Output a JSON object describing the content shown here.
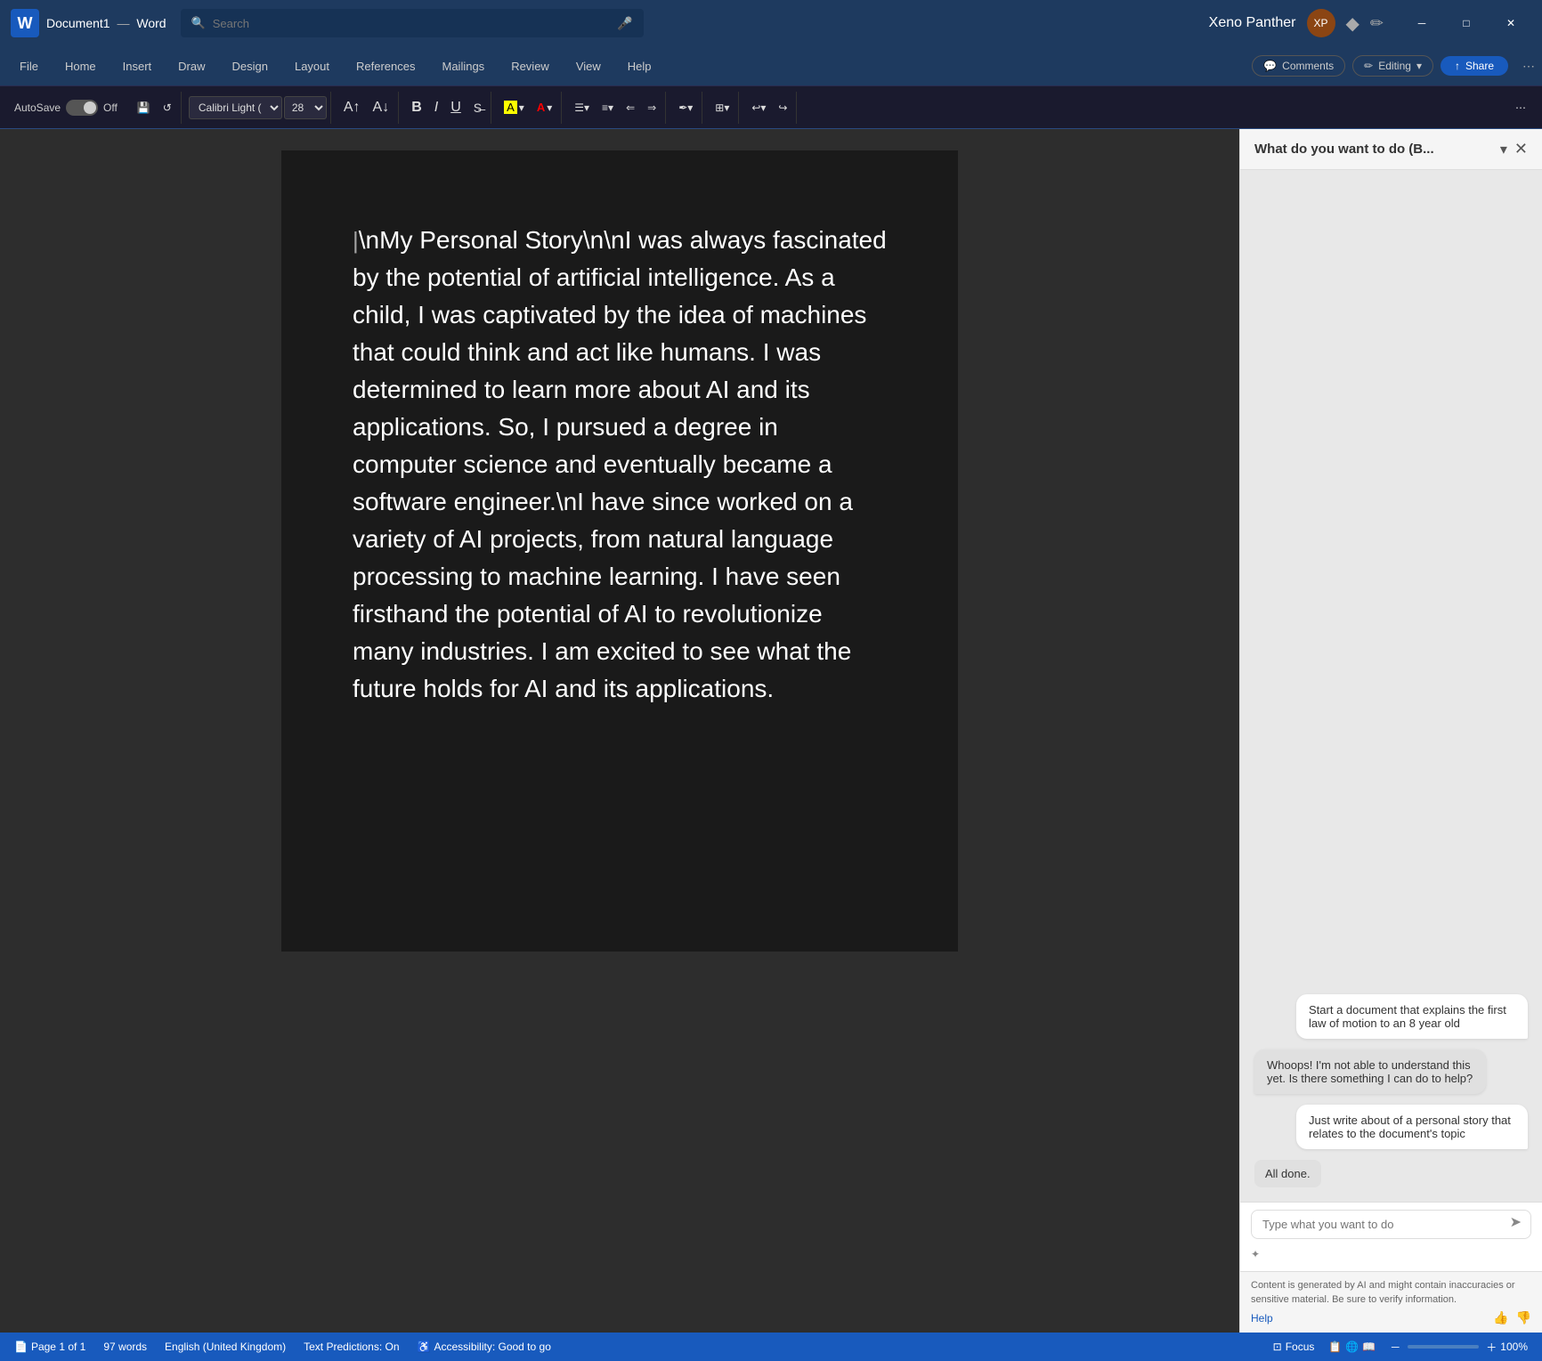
{
  "titlebar": {
    "word_icon": "W",
    "doc_name": "Document1",
    "separator": "—",
    "app_name": "Word",
    "search_placeholder": "Search",
    "mic_icon": "🎤",
    "username": "Xeno Panther",
    "avatar_initials": "XP",
    "minimize_icon": "─",
    "maximize_icon": "□",
    "close_icon": "✕"
  },
  "ribbon": {
    "tabs": [
      {
        "label": "File",
        "active": false
      },
      {
        "label": "Home",
        "active": false
      },
      {
        "label": "Insert",
        "active": false
      },
      {
        "label": "Draw",
        "active": false
      },
      {
        "label": "Design",
        "active": false
      },
      {
        "label": "Layout",
        "active": false
      },
      {
        "label": "References",
        "active": false
      },
      {
        "label": "Mailings",
        "active": false
      },
      {
        "label": "Review",
        "active": false
      },
      {
        "label": "View",
        "active": false
      },
      {
        "label": "Help",
        "active": false
      }
    ],
    "autosave_label": "AutoSave",
    "toggle_state": "Off",
    "font_name": "Calibri Light (",
    "font_size": "28",
    "bold": "B",
    "italic": "I",
    "underline": "U",
    "strikethrough": "S",
    "highlight": "A",
    "font_color": "A",
    "bullets": "≡",
    "numbered": "≡",
    "indent_dec": "⇐",
    "indent_inc": "⇒",
    "table_icon": "⊞",
    "undo": "↩",
    "redo": "↪",
    "comments_label": "Comments",
    "editing_label": "Editing",
    "editing_caret": "▾",
    "share_label": "Share"
  },
  "document": {
    "content": "\\nMy Personal Story\\n\\nI was always fascinated by the potential of artificial intelligence. As a child, I was captivated by the idea of machines that could think and act like humans. I was determined to learn more about AI and its applications. So, I pursued a degree in computer science and eventually became a software engineer.\\nI have since worked on a variety of AI projects, from natural language processing to machine learning. I have seen firsthand the potential of AI to revolutionize many industries. I am excited to see what the future holds for AI and its applications."
  },
  "ai_panel": {
    "title": "What do you want to do (B...",
    "chevron_icon": "▾",
    "close_icon": "✕",
    "messages": [
      {
        "type": "user",
        "text": "Start a document that explains the first law of motion to an 8 year old"
      },
      {
        "type": "ai",
        "text": "Whoops! I'm not able to understand this yet. Is there something I can do to help?"
      },
      {
        "type": "user",
        "text": "Just write about of a personal story that relates to the document's topic"
      },
      {
        "type": "simple",
        "text": "All done."
      }
    ],
    "input_placeholder": "Type what you want to do",
    "send_icon": "➤",
    "sparkle_icon": "✦",
    "footer_text": "Content is generated by AI and might contain inaccuracies or sensitive material. Be sure to verify information.",
    "help_label": "Help",
    "thumbs_up": "👍",
    "thumbs_down": "👎"
  },
  "statusbar": {
    "page_info": "Page 1 of 1",
    "word_count": "97 words",
    "language": "English (United Kingdom)",
    "text_predictions": "Text Predictions: On",
    "accessibility": "Accessibility: Good to go",
    "focus_label": "Focus",
    "zoom_level": "100%"
  }
}
